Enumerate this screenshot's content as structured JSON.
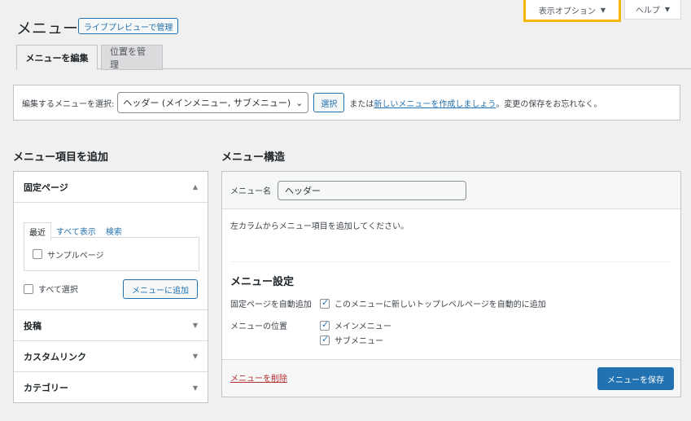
{
  "header": {
    "title": "メニュー",
    "live_preview_label": "ライブプレビューで管理",
    "screen_options_label": "表示オプション",
    "help_label": "ヘルプ"
  },
  "tabs": [
    {
      "label": "メニューを編集",
      "active": true
    },
    {
      "label": "位置を管理",
      "active": false
    }
  ],
  "select_bar": {
    "prompt": "編集するメニューを選択:",
    "selected_menu": "ヘッダー (メインメニュー, サブメニュー)",
    "select_button": "選択",
    "or_text": "または",
    "create_link": "新しいメニューを作成しましょう",
    "suffix_text": "。変更の保存をお忘れなく。"
  },
  "left_panel": {
    "heading": "メニュー項目を追加",
    "sections": [
      {
        "label": "固定ページ",
        "expanded": true
      },
      {
        "label": "投稿",
        "expanded": false
      },
      {
        "label": "カスタムリンク",
        "expanded": false
      },
      {
        "label": "カテゴリー",
        "expanded": false
      }
    ],
    "mini_tabs": [
      "最近",
      "すべて表示",
      "検索"
    ],
    "page_items": [
      "サンプルページ"
    ],
    "select_all_label": "すべて選択",
    "add_button": "メニューに追加"
  },
  "right_panel": {
    "heading": "メニュー構造",
    "menu_name_label": "メニュー名",
    "menu_name_value": "ヘッダー",
    "instruction": "左カラムからメニュー項目を追加してください。",
    "settings_heading": "メニュー設定",
    "auto_add_label": "固定ページを自動追加",
    "auto_add_option": "このメニューに新しいトップレベルページを自動的に追加",
    "location_label": "メニューの位置",
    "locations": [
      "メインメニュー",
      "サブメニュー"
    ],
    "delete_link": "メニューを削除",
    "save_button": "メニューを保存"
  },
  "colors": {
    "accent": "#2271b1",
    "highlight": "#f5b800",
    "danger": "#b32d2e"
  }
}
